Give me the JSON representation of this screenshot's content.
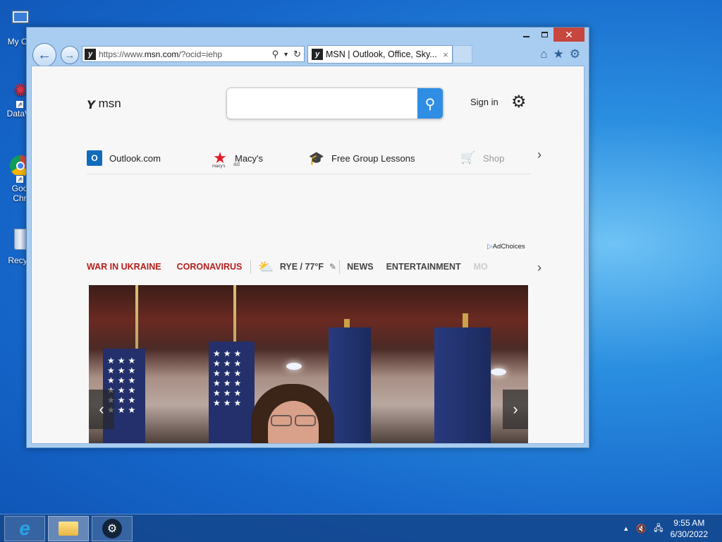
{
  "desktop": {
    "icons": [
      {
        "label": "My Co",
        "name": "my-computer"
      },
      {
        "label": "DataW",
        "name": "datawrapper"
      },
      {
        "label": "Goo\nChr",
        "name": "google-chrome"
      },
      {
        "label": "Recyc",
        "name": "recycle-bin"
      }
    ]
  },
  "browser": {
    "url_prefix": "https://www.",
    "url_domain": "msn.com",
    "url_suffix": "/?ocid=iehp",
    "tab_title": "MSN | Outlook, Office, Sky...",
    "tab_close": "×"
  },
  "page": {
    "logo_text": "msn",
    "search_placeholder": "",
    "sign_in": "Sign in",
    "quicklinks": [
      {
        "label": "Outlook.com",
        "icon": "outlook-icon"
      },
      {
        "label": "Macy's",
        "sub": "ad",
        "icon": "macys-star-icon",
        "brand": "macy's"
      },
      {
        "label": "Free Group Lessons",
        "icon": "graduation-cap-icon"
      },
      {
        "label": "Shop",
        "icon": "shopping-cart-icon"
      }
    ],
    "adchoices": "AdChoices",
    "nav": {
      "war": "WAR IN UKRAINE",
      "corona": "CORONAVIRUS",
      "weather": "RYE / 77°F",
      "news": "NEWS",
      "entertainment": "ENTERTAINMENT",
      "more": "MO"
    }
  },
  "taskbar": {
    "time": "9:55 AM",
    "date": "6/30/2022"
  },
  "colors": {
    "accent": "#2f8de4",
    "nav_red": "#b5201d",
    "close_button": "#c7463d"
  }
}
